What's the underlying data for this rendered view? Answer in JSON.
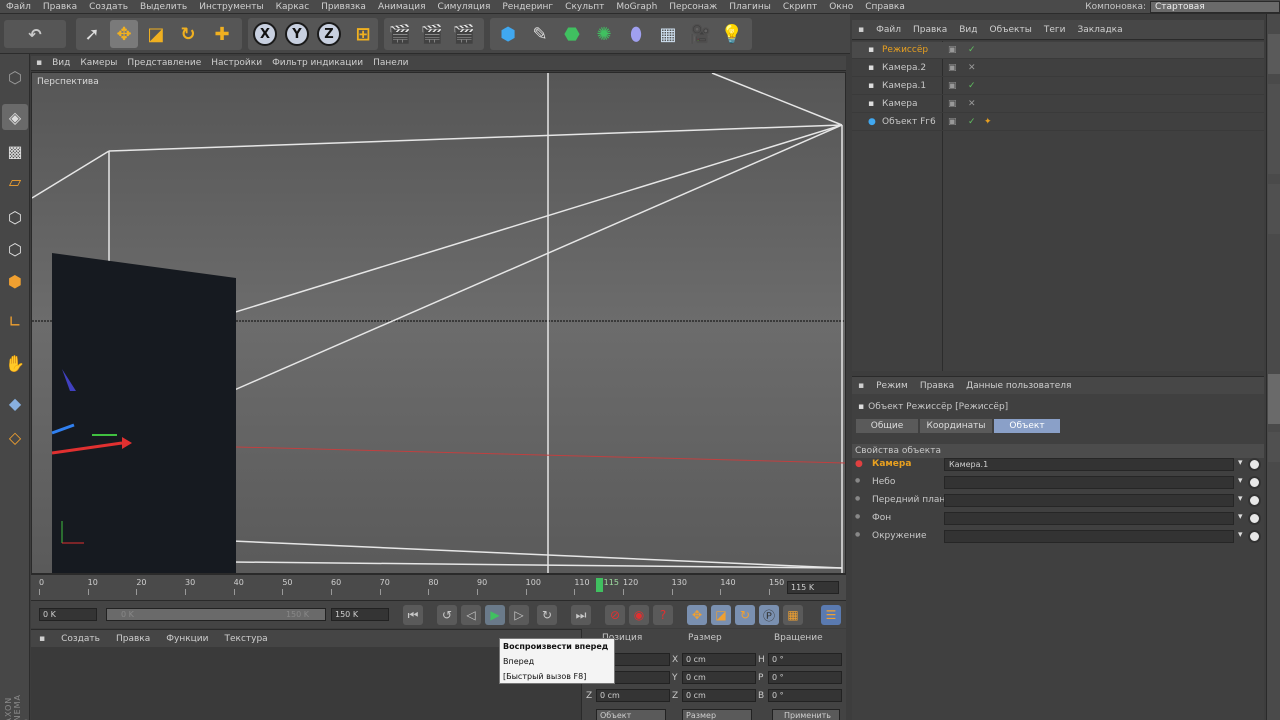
{
  "menubar": {
    "items": [
      "Файл",
      "Правка",
      "Создать",
      "Выделить",
      "Инструменты",
      "Каркас",
      "Привязка",
      "Анимация",
      "Симуляция",
      "Рендеринг",
      "Скульпт",
      "MoGraph",
      "Персонаж",
      "Плагины",
      "Скрипт",
      "Окно",
      "Справка"
    ],
    "layout_label": "Компоновка:",
    "layout_value": "Стартовая"
  },
  "toolbar": {
    "axes": [
      "X",
      "Y",
      "Z"
    ]
  },
  "viewport": {
    "menu": [
      "Вид",
      "Камеры",
      "Представление",
      "Настройки",
      "Фильтр индикации",
      "Панели"
    ],
    "label": "Перспектива"
  },
  "timeline": {
    "ticks": [
      "0",
      "10",
      "20",
      "30",
      "40",
      "50",
      "60",
      "70",
      "80",
      "90",
      "100",
      "110",
      "120",
      "130",
      "140",
      "150"
    ],
    "current_frame": "115",
    "frame_readout": "115 K",
    "start_field": "0 K",
    "range_start": "0 K",
    "range_end": "150 K",
    "end_field": "150 K"
  },
  "tooltip": {
    "lines": [
      "Воспроизвести вперед",
      "Вперед",
      "[Быстрый вызов F8]"
    ]
  },
  "material_manager": {
    "menu": [
      "Создать",
      "Правка",
      "Функции",
      "Текстура"
    ]
  },
  "coordinates": {
    "headers": [
      "Позиция",
      "Размер",
      "Вращение"
    ],
    "rows": [
      {
        "axis_pos": "X",
        "pos": "",
        "axis_size": "X",
        "size": "0 cm",
        "axis_rot": "H",
        "rot": "0 °"
      },
      {
        "axis_pos": "Y",
        "pos": "",
        "axis_size": "Y",
        "size": "0 cm",
        "axis_rot": "P",
        "rot": "0 °"
      },
      {
        "axis_pos": "Z",
        "pos": "0 cm",
        "axis_size": "Z",
        "size": "0 cm",
        "axis_rot": "B",
        "rot": "0 °"
      }
    ],
    "mode_select": "Объект",
    "size_select": "Размер",
    "apply_button": "Применить"
  },
  "object_manager": {
    "menu": [
      "Файл",
      "Правка",
      "Вид",
      "Объекты",
      "Теги",
      "Закладка"
    ],
    "objects": [
      {
        "name": "Режиссёр",
        "selected": true,
        "color": "#e8a020"
      },
      {
        "name": "Камера.2",
        "selected": false,
        "color": "#c8c8c8"
      },
      {
        "name": "Камера.1",
        "selected": false,
        "color": "#c8c8c8"
      },
      {
        "name": "Камера",
        "selected": false,
        "color": "#c8c8c8"
      },
      {
        "name": "Объект Fг6",
        "selected": false,
        "color": "#c8c8c8"
      }
    ]
  },
  "attribute_manager": {
    "menu": [
      "Режим",
      "Правка",
      "Данные пользователя"
    ],
    "title": "Объект Режиссёр [Режиссёр]",
    "tabs": [
      {
        "label": "Общие",
        "active": false
      },
      {
        "label": "Координаты",
        "active": false
      },
      {
        "label": "Объект",
        "active": true
      }
    ],
    "section": "Свойства объекта",
    "fields": [
      {
        "label": "Камера",
        "value": "Камера.1",
        "highlight": true
      },
      {
        "label": "Небо",
        "value": "",
        "highlight": false
      },
      {
        "label": "Передний план",
        "value": "",
        "highlight": false
      },
      {
        "label": "Фон",
        "value": "",
        "highlight": false
      },
      {
        "label": "Окружение",
        "value": "",
        "highlight": false
      }
    ]
  },
  "branding": "MAXON CINEMA 4D",
  "colors": {
    "accent": "#e8a020",
    "selection": "#8aa0c8",
    "play_green": "#40c060",
    "record_red": "#d03030"
  }
}
